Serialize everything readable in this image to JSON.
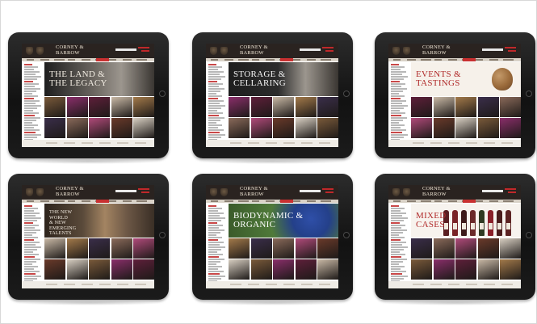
{
  "brand": {
    "logo_line1": "CORNEY &",
    "logo_line2": "BARROW",
    "colors": {
      "header": "#2a2320",
      "nav": "#d9d2c7",
      "accent_red": "#c0282a",
      "gold": "#c9a24a",
      "cream": "#efe6d6"
    }
  },
  "screens": [
    {
      "id": "land-legacy",
      "banner_title": "THE LAND &\nTHE LEGACY",
      "banner_style": "photo-dark",
      "title_color": "#f2ece2",
      "banner_background": "#6b6660"
    },
    {
      "id": "storage-cellaring",
      "banner_title": "STORAGE &\nCELLARING",
      "banner_style": "photo-dark",
      "title_color": "#f4f4f4",
      "banner_background": "#2c2c2c"
    },
    {
      "id": "events-tastings",
      "banner_title": "EVENTS &\nTASTINGS",
      "banner_style": "light",
      "title_color": "#b02a2a",
      "banner_background": "#f6f1ea"
    },
    {
      "id": "new-world",
      "banner_title": "THE NEW\nWORLD\n& NEW\nEMERGING\nTALENTS",
      "banner_style": "photo-warm",
      "title_color": "#f4ede2",
      "banner_background": "#5a4a3a"
    },
    {
      "id": "biodynamic-organic",
      "banner_title": "BIODYNAMIC &\nORGANIC",
      "banner_style": "photo-green",
      "title_color": "#ffffff",
      "banner_background": "#4f7a3a"
    },
    {
      "id": "mixed-cases",
      "banner_title": "MIXED\nCASES",
      "banner_style": "light",
      "title_color": "#b02a2a",
      "banner_background": "#f7f3ee"
    }
  ],
  "tile_colors": [
    "#7a5a3a",
    "#8a2e6a",
    "#5e1f3a",
    "#c9b9a6",
    "#a37a4a",
    "#3a2e4a",
    "#8a6a5a",
    "#b04a7a",
    "#6a3a2a",
    "#d8cfc2"
  ]
}
